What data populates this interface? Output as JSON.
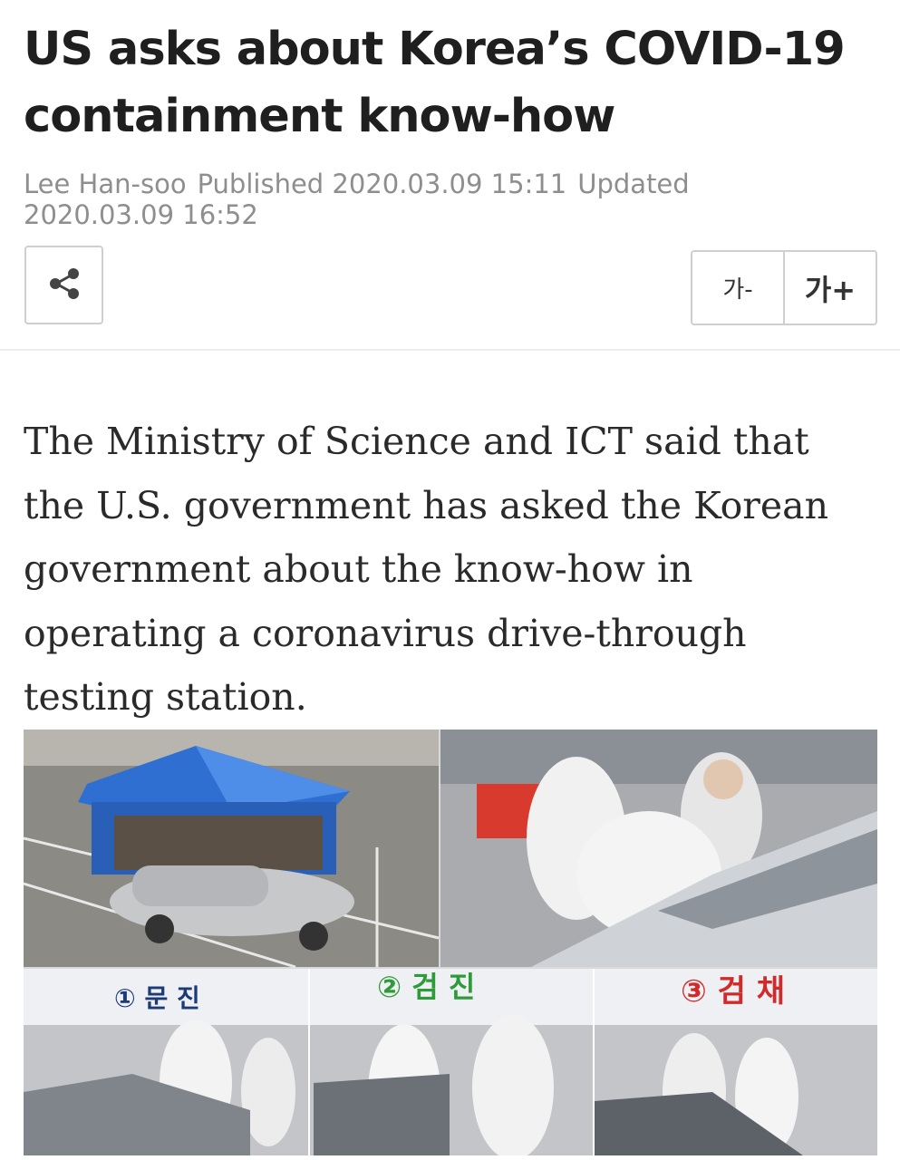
{
  "article": {
    "headline": "US asks about Korea’s COVID-19 containment know-how",
    "author": "Lee Han-soo",
    "published": "Published 2020.03.09  15:11",
    "updated": "Updated 2020.03.09 16:52",
    "body": "The Ministry of Science and ICT said that the U.S. government has asked the Korean government about the know-how in operating a coronavirus drive-through testing station."
  },
  "toolbar": {
    "share_icon": "share-icon",
    "font_decrease_label": "가-",
    "font_increase_label": "가+"
  },
  "photo": {
    "stage_1": "① 문 진",
    "stage_2": "② 검 진",
    "stage_3": "③ 검 채"
  }
}
